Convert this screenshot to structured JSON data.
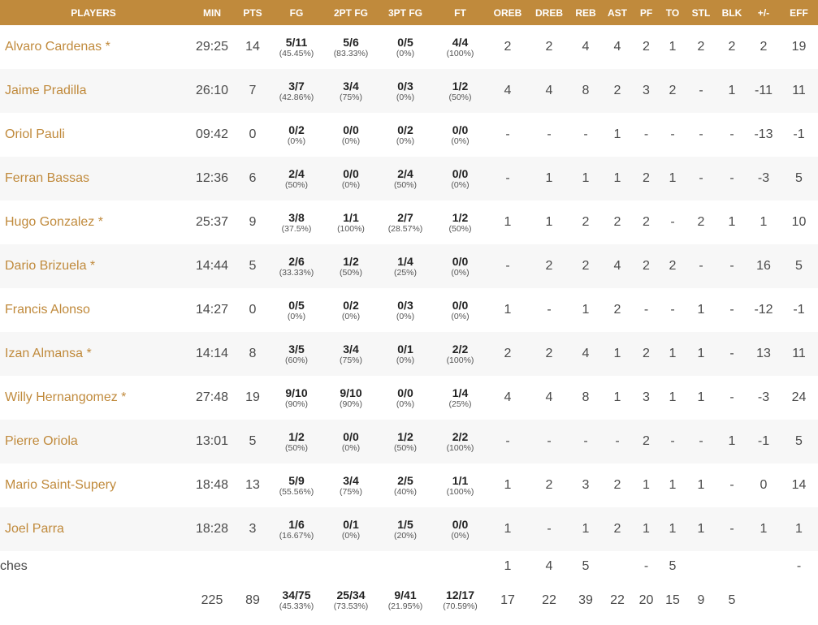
{
  "headers": [
    "PLAYERS",
    "MIN",
    "PTS",
    "FG",
    "2PT FG",
    "3PT FG",
    "FT",
    "OREB",
    "DREB",
    "REB",
    "AST",
    "PF",
    "TO",
    "STL",
    "BLK",
    "+/-",
    "EFF"
  ],
  "players": [
    {
      "name": "Alvaro Cardenas *",
      "min": "29:25",
      "pts": "14",
      "fg": "5/11",
      "fg_pct": "(45.45%)",
      "p2": "5/6",
      "p2_pct": "(83.33%)",
      "p3": "0/5",
      "p3_pct": "(0%)",
      "ft": "4/4",
      "ft_pct": "(100%)",
      "oreb": "2",
      "dreb": "2",
      "reb": "4",
      "ast": "4",
      "pf": "2",
      "to": "1",
      "stl": "2",
      "blk": "2",
      "pm": "2",
      "eff": "19"
    },
    {
      "name": "Jaime Pradilla",
      "min": "26:10",
      "pts": "7",
      "fg": "3/7",
      "fg_pct": "(42.86%)",
      "p2": "3/4",
      "p2_pct": "(75%)",
      "p3": "0/3",
      "p3_pct": "(0%)",
      "ft": "1/2",
      "ft_pct": "(50%)",
      "oreb": "4",
      "dreb": "4",
      "reb": "8",
      "ast": "2",
      "pf": "3",
      "to": "2",
      "stl": "-",
      "blk": "1",
      "pm": "-11",
      "eff": "11"
    },
    {
      "name": "Oriol Pauli",
      "min": "09:42",
      "pts": "0",
      "fg": "0/2",
      "fg_pct": "(0%)",
      "p2": "0/0",
      "p2_pct": "(0%)",
      "p3": "0/2",
      "p3_pct": "(0%)",
      "ft": "0/0",
      "ft_pct": "(0%)",
      "oreb": "-",
      "dreb": "-",
      "reb": "-",
      "ast": "1",
      "pf": "-",
      "to": "-",
      "stl": "-",
      "blk": "-",
      "pm": "-13",
      "eff": "-1"
    },
    {
      "name": "Ferran Bassas",
      "min": "12:36",
      "pts": "6",
      "fg": "2/4",
      "fg_pct": "(50%)",
      "p2": "0/0",
      "p2_pct": "(0%)",
      "p3": "2/4",
      "p3_pct": "(50%)",
      "ft": "0/0",
      "ft_pct": "(0%)",
      "oreb": "-",
      "dreb": "1",
      "reb": "1",
      "ast": "1",
      "pf": "2",
      "to": "1",
      "stl": "-",
      "blk": "-",
      "pm": "-3",
      "eff": "5"
    },
    {
      "name": "Hugo Gonzalez *",
      "min": "25:37",
      "pts": "9",
      "fg": "3/8",
      "fg_pct": "(37.5%)",
      "p2": "1/1",
      "p2_pct": "(100%)",
      "p3": "2/7",
      "p3_pct": "(28.57%)",
      "ft": "1/2",
      "ft_pct": "(50%)",
      "oreb": "1",
      "dreb": "1",
      "reb": "2",
      "ast": "2",
      "pf": "2",
      "to": "-",
      "stl": "2",
      "blk": "1",
      "pm": "1",
      "eff": "10"
    },
    {
      "name": "Dario Brizuela *",
      "min": "14:44",
      "pts": "5",
      "fg": "2/6",
      "fg_pct": "(33.33%)",
      "p2": "1/2",
      "p2_pct": "(50%)",
      "p3": "1/4",
      "p3_pct": "(25%)",
      "ft": "0/0",
      "ft_pct": "(0%)",
      "oreb": "-",
      "dreb": "2",
      "reb": "2",
      "ast": "4",
      "pf": "2",
      "to": "2",
      "stl": "-",
      "blk": "-",
      "pm": "16",
      "eff": "5"
    },
    {
      "name": "Francis Alonso",
      "min": "14:27",
      "pts": "0",
      "fg": "0/5",
      "fg_pct": "(0%)",
      "p2": "0/2",
      "p2_pct": "(0%)",
      "p3": "0/3",
      "p3_pct": "(0%)",
      "ft": "0/0",
      "ft_pct": "(0%)",
      "oreb": "1",
      "dreb": "-",
      "reb": "1",
      "ast": "2",
      "pf": "-",
      "to": "-",
      "stl": "1",
      "blk": "-",
      "pm": "-12",
      "eff": "-1"
    },
    {
      "name": "Izan Almansa *",
      "min": "14:14",
      "pts": "8",
      "fg": "3/5",
      "fg_pct": "(60%)",
      "p2": "3/4",
      "p2_pct": "(75%)",
      "p3": "0/1",
      "p3_pct": "(0%)",
      "ft": "2/2",
      "ft_pct": "(100%)",
      "oreb": "2",
      "dreb": "2",
      "reb": "4",
      "ast": "1",
      "pf": "2",
      "to": "1",
      "stl": "1",
      "blk": "-",
      "pm": "13",
      "eff": "11"
    },
    {
      "name": "Willy Hernangomez *",
      "min": "27:48",
      "pts": "19",
      "fg": "9/10",
      "fg_pct": "(90%)",
      "p2": "9/10",
      "p2_pct": "(90%)",
      "p3": "0/0",
      "p3_pct": "(0%)",
      "ft": "1/4",
      "ft_pct": "(25%)",
      "oreb": "4",
      "dreb": "4",
      "reb": "8",
      "ast": "1",
      "pf": "3",
      "to": "1",
      "stl": "1",
      "blk": "-",
      "pm": "-3",
      "eff": "24"
    },
    {
      "name": "Pierre Oriola",
      "min": "13:01",
      "pts": "5",
      "fg": "1/2",
      "fg_pct": "(50%)",
      "p2": "0/0",
      "p2_pct": "(0%)",
      "p3": "1/2",
      "p3_pct": "(50%)",
      "ft": "2/2",
      "ft_pct": "(100%)",
      "oreb": "-",
      "dreb": "-",
      "reb": "-",
      "ast": "-",
      "pf": "2",
      "to": "-",
      "stl": "-",
      "blk": "1",
      "pm": "-1",
      "eff": "5"
    },
    {
      "name": "Mario Saint-Supery",
      "min": "18:48",
      "pts": "13",
      "fg": "5/9",
      "fg_pct": "(55.56%)",
      "p2": "3/4",
      "p2_pct": "(75%)",
      "p3": "2/5",
      "p3_pct": "(40%)",
      "ft": "1/1",
      "ft_pct": "(100%)",
      "oreb": "1",
      "dreb": "2",
      "reb": "3",
      "ast": "2",
      "pf": "1",
      "to": "1",
      "stl": "1",
      "blk": "-",
      "pm": "0",
      "eff": "14"
    },
    {
      "name": "Joel Parra",
      "min": "18:28",
      "pts": "3",
      "fg": "1/6",
      "fg_pct": "(16.67%)",
      "p2": "0/1",
      "p2_pct": "(0%)",
      "p3": "1/5",
      "p3_pct": "(20%)",
      "ft": "0/0",
      "ft_pct": "(0%)",
      "oreb": "1",
      "dreb": "-",
      "reb": "1",
      "ast": "2",
      "pf": "1",
      "to": "1",
      "stl": "1",
      "blk": "-",
      "pm": "1",
      "eff": "1"
    }
  ],
  "coaches": {
    "label": "ches",
    "oreb": "1",
    "dreb": "4",
    "reb": "5",
    "ast": "",
    "pf": "-",
    "to": "5",
    "stl": "",
    "blk": "",
    "pm": "",
    "eff": "-"
  },
  "totals": {
    "min": "225",
    "pts": "89",
    "fg": "34/75",
    "fg_pct": "(45.33%)",
    "p2": "25/34",
    "p2_pct": "(73.53%)",
    "p3": "9/41",
    "p3_pct": "(21.95%)",
    "ft": "12/17",
    "ft_pct": "(70.59%)",
    "oreb": "17",
    "dreb": "22",
    "reb": "39",
    "ast": "22",
    "pf": "20",
    "to": "15",
    "stl": "9",
    "blk": "5",
    "pm": "",
    "eff": ""
  },
  "colors": {
    "accent": "#c08a3c",
    "row_alt": "#f7f7f7",
    "text": "#4a4a4a"
  }
}
